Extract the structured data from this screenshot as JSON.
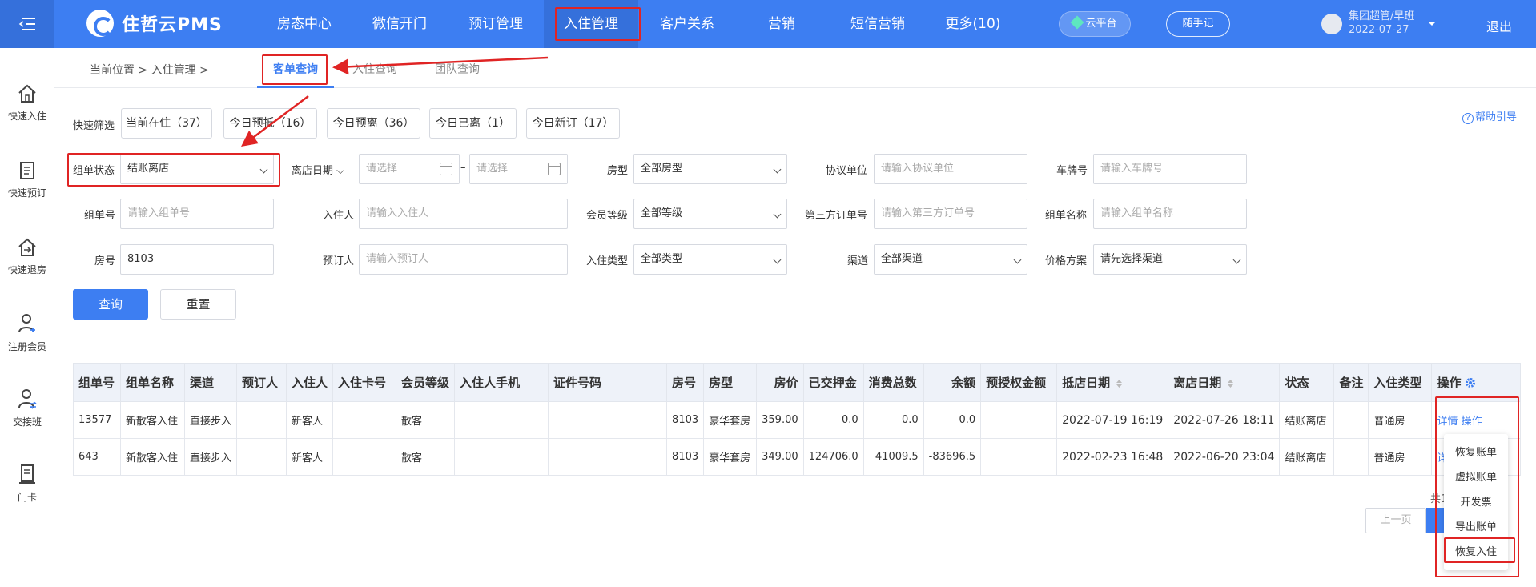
{
  "app": {
    "name": "住哲云PMS"
  },
  "nav": {
    "items": [
      "房态中心",
      "微信开门",
      "预订管理",
      "入住管理",
      "客户关系",
      "营销",
      "短信营销",
      "更多(10)"
    ],
    "cloud": "云平台",
    "memo": "随手记",
    "user_name": "集团超管/早班",
    "user_date": "2022-07-27",
    "logout": "退出"
  },
  "sidebar": {
    "items": [
      "快速入住",
      "快速预订",
      "快速退房",
      "注册会员",
      "交接班",
      "门卡"
    ]
  },
  "breadcrumb": {
    "text": "当前位置 > 入住管理 >"
  },
  "subtabs": [
    "客单查询",
    "入住查询",
    "团队查询"
  ],
  "quick": {
    "label": "快速筛选",
    "buttons": [
      "当前在住（37）",
      "今日预抵（16）",
      "今日预离（36）",
      "今日已离（1）",
      "今日新订（17）"
    ]
  },
  "help": "帮助引导",
  "filters": {
    "status_label": "组单状态",
    "status_value": "结账离店",
    "leave_date_label": "离店日期",
    "date_ph": "请选择",
    "date_sep": "–",
    "room_type_label": "房型",
    "room_type_value": "全部房型",
    "agreement_label": "协议单位",
    "agreement_ph": "请输入协议单位",
    "plate_label": "车牌号",
    "plate_ph": "请输入车牌号",
    "order_no_label": "组单号",
    "order_no_ph": "请输入组单号",
    "guest_label": "入住人",
    "guest_ph": "请输入入住人",
    "member_label": "会员等级",
    "member_value": "全部等级",
    "third_label": "第三方订单号",
    "third_ph": "请输入第三方订单号",
    "order_name_label": "组单名称",
    "order_name_ph": "请输入组单名称",
    "room_no_label": "房号",
    "room_no_value": "8103",
    "booker_label": "预订人",
    "booker_ph": "请输入预订人",
    "checkin_type_label": "入住类型",
    "checkin_type_value": "全部类型",
    "channel_label": "渠道",
    "channel_value": "全部渠道",
    "price_label": "价格方案",
    "price_value": "请先选择渠道"
  },
  "buttons": {
    "query": "查询",
    "reset": "重置"
  },
  "table": {
    "headers": [
      "组单号",
      "组单名称",
      "渠道",
      "预订人",
      "入住人",
      "入住卡号",
      "会员等级",
      "入住人手机",
      "证件号码",
      "房号",
      "房型",
      "房价",
      "已交押金",
      "消费总数",
      "余额",
      "预授权金额",
      "抵店日期",
      "离店日期",
      "状态",
      "备注",
      "入住类型",
      "操作"
    ],
    "rows": [
      [
        "13577",
        "新散客入住",
        "直接步入",
        "",
        "新客人",
        "",
        "散客",
        "",
        "",
        "8103",
        "豪华套房",
        "359.00",
        "0.0",
        "0.0",
        "0.0",
        "",
        "2022-07-19 16:19",
        "2022-07-26 18:11",
        "结账离店",
        "",
        "普通房"
      ],
      [
        "643",
        "新散客入住",
        "直接步入",
        "",
        "新客人",
        "",
        "散客",
        "",
        "",
        "8103",
        "豪华套房",
        "349.00",
        "124706.0",
        "41009.5",
        "-83696.5",
        "",
        "2022-02-23 16:48",
        "2022-06-20 23:04",
        "结账离店",
        "",
        "普通房"
      ]
    ],
    "op_detail": "详情",
    "op_action": "操作"
  },
  "dropdown": [
    "恢复账单",
    "虚拟账单",
    "开发票",
    "导出账单",
    "恢复入住"
  ],
  "pagination": {
    "prev": "上一页",
    "total": "共1"
  }
}
